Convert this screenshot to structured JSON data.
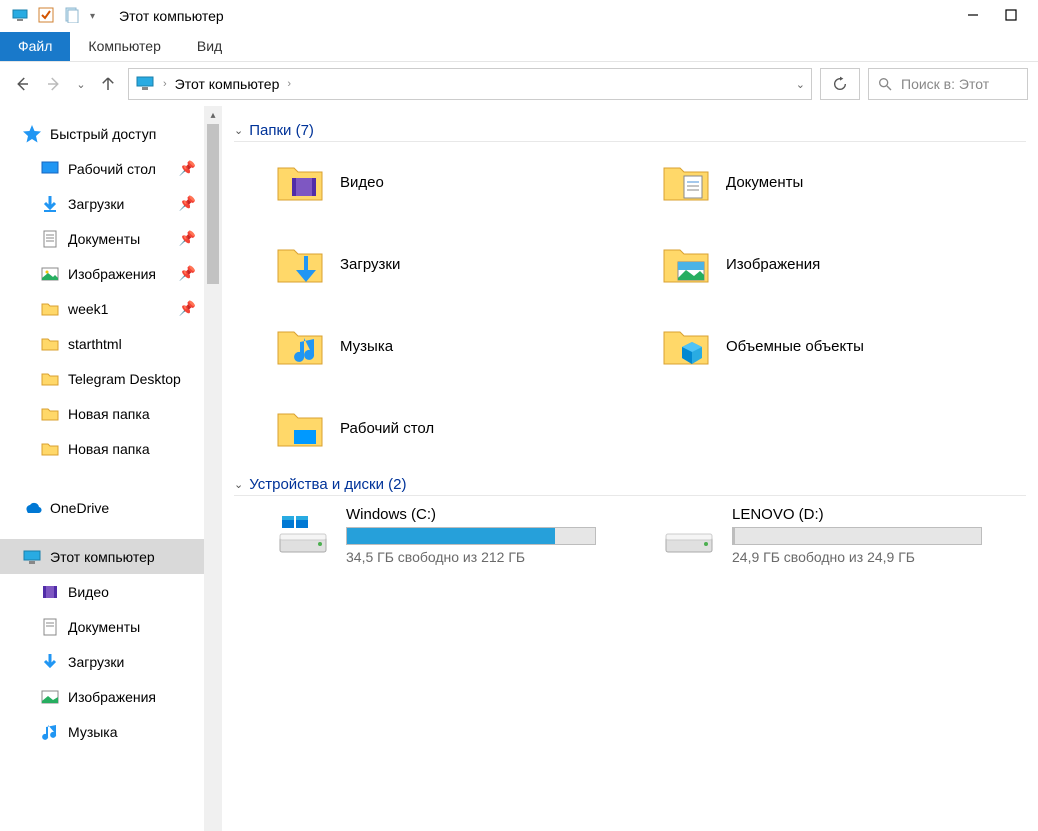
{
  "titlebar": {
    "title": "Этот компьютер"
  },
  "tabs": {
    "file": "Файл",
    "computer": "Компьютер",
    "view": "Вид"
  },
  "nav": {
    "breadcrumb": "Этот компьютер",
    "search_placeholder": "Поиск в: Этот"
  },
  "sidebar": {
    "quick_access": "Быстрый доступ",
    "items": [
      {
        "label": "Рабочий стол",
        "pinned": true
      },
      {
        "label": "Загрузки",
        "pinned": true
      },
      {
        "label": "Документы",
        "pinned": true
      },
      {
        "label": "Изображения",
        "pinned": true
      },
      {
        "label": "week1",
        "pinned": true
      },
      {
        "label": "starthtml",
        "pinned": false
      },
      {
        "label": "Telegram Desktop",
        "pinned": false
      },
      {
        "label": "Новая папка",
        "pinned": false
      },
      {
        "label": "Новая папка",
        "pinned": false
      }
    ],
    "onedrive": "OneDrive",
    "this_pc": "Этот компьютер",
    "pc_children": [
      {
        "label": "Видео"
      },
      {
        "label": "Документы"
      },
      {
        "label": "Загрузки"
      },
      {
        "label": "Изображения"
      },
      {
        "label": "Музыка"
      }
    ]
  },
  "content": {
    "folders_header": "Папки (7)",
    "folders": [
      {
        "label": "Видео",
        "icon": "video"
      },
      {
        "label": "Документы",
        "icon": "documents"
      },
      {
        "label": "Загрузки",
        "icon": "downloads"
      },
      {
        "label": "Изображения",
        "icon": "pictures"
      },
      {
        "label": "Музыка",
        "icon": "music"
      },
      {
        "label": "Объемные объекты",
        "icon": "3d"
      },
      {
        "label": "Рабочий стол",
        "icon": "desktop"
      }
    ],
    "drives_header": "Устройства и диски (2)",
    "drives": [
      {
        "name": "Windows (C:)",
        "free_text": "34,5 ГБ свободно из 212 ГБ",
        "fill_pct": 84,
        "os": true
      },
      {
        "name": "LENOVO (D:)",
        "free_text": "24,9 ГБ свободно из 24,9 ГБ",
        "fill_pct": 1,
        "os": false
      }
    ]
  }
}
